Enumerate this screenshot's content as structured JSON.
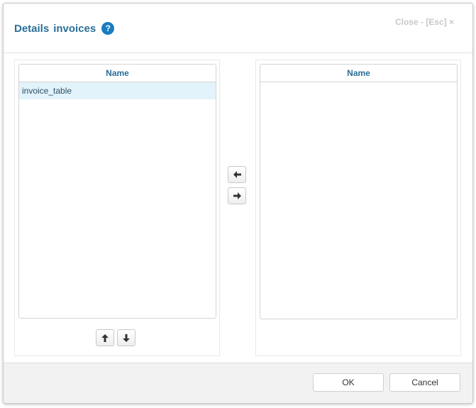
{
  "dialog": {
    "title_words": [
      "Details",
      "invoices"
    ],
    "help_label": "?",
    "close_label": "Close - [Esc] ×"
  },
  "left_list": {
    "column_header": "Name",
    "rows": [
      "invoice_table"
    ],
    "selected_row": "invoice_table"
  },
  "right_list": {
    "column_header": "Name",
    "rows": []
  },
  "icons": {
    "move_left": "arrow-left-icon",
    "move_right": "arrow-right-icon",
    "move_up": "arrow-up-icon",
    "move_down": "arrow-down-icon"
  },
  "footer": {
    "ok_label": "OK",
    "cancel_label": "Cancel"
  },
  "colors": {
    "accent": "#2a6f99",
    "help_badge": "#1a7bbf",
    "selected_row": "#e3f3fb"
  }
}
